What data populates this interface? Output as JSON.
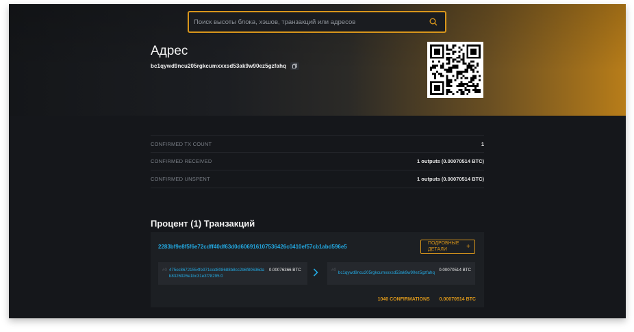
{
  "search": {
    "placeholder": "Поиск высоты блока, хэшов, транзакций или адресов"
  },
  "address_section": {
    "title": "Адрес",
    "address": "bc1qywd9ncu205rgkcumxxxsd53ak9w90ez5gzfahq"
  },
  "info": [
    {
      "label": "CONFIRMED TX COUNT",
      "value": "1"
    },
    {
      "label": "CONFIRMED RECEIVED",
      "value": "1 outputs (0.00070514 BTC)"
    },
    {
      "label": "CONFIRMED UNSPENT",
      "value": "1 outputs (0.00070514 BTC)"
    }
  ],
  "transactions": {
    "heading": "Процент (1) Транзакций",
    "tx": {
      "hash": "2283bf9e8f5f6e72cdff40df63d0d606916107536426c0410ef57cb1abd596e5",
      "details_label": "ПОДРОБНЫЕ ДЕТАЛИ",
      "details_plus": "+",
      "input": {
        "index": "#0",
        "address": "475cc86721554fe971ccd808688b8cc2b6f80636dab8326926e1bc31e3f78295:0",
        "amount": "0.00076366 BTC"
      },
      "output": {
        "index": "#0",
        "address": "bc1qywd9ncu205rgkcumxxxsd53ak9w90ez5gzfahq",
        "amount": "0.00070514 BTC"
      },
      "confirmations": "1040 CONFIRMATIONS",
      "total": "0.00070514 BTC"
    }
  },
  "icons": {
    "search": "search-icon",
    "copy": "copy-icon",
    "arrow": "chevron-right-icon"
  },
  "colors": {
    "accent": "#d9961b",
    "link": "#23a8e0",
    "background": "#15171b"
  }
}
